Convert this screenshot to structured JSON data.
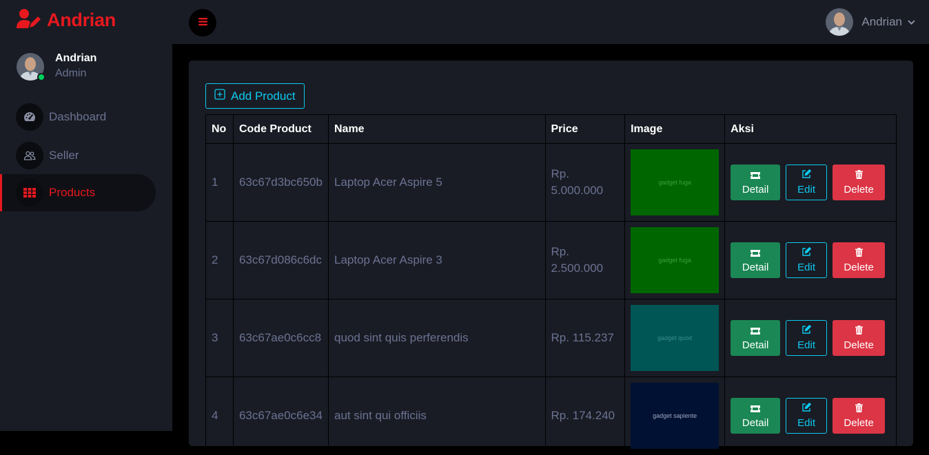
{
  "brand": {
    "name": "Andrian"
  },
  "profile": {
    "name": "Andrian",
    "role": "Admin"
  },
  "nav": [
    {
      "label": "Dashboard",
      "icon": "speedometer-icon"
    },
    {
      "label": "Seller",
      "icon": "people-icon"
    },
    {
      "label": "Products",
      "icon": "grid-icon",
      "active": true
    }
  ],
  "topbar": {
    "username": "Andrian"
  },
  "toolbar": {
    "add_label": "Add Product"
  },
  "table": {
    "headers": [
      "No",
      "Code Product",
      "Name",
      "Price",
      "Image",
      "Aksi"
    ],
    "rows": [
      {
        "no": "1",
        "code": "63c67d3bc650b",
        "name": "Laptop Acer Aspire 5",
        "price": "Rp. 5.000.000",
        "image_text": "gadget fuga",
        "image_bg": "#006600",
        "image_fg": "#3aa23a"
      },
      {
        "no": "2",
        "code": "63c67d086c6dc",
        "name": "Laptop Acer Aspire 3",
        "price": "Rp. 2.500.000",
        "image_text": "gadget fuga",
        "image_bg": "#006600",
        "image_fg": "#3aa23a"
      },
      {
        "no": "3",
        "code": "63c67ae0c6cc8",
        "name": "quod sint quis perferendis",
        "price": "Rp. 115.237",
        "image_text": "gadget quod",
        "image_bg": "#005555",
        "image_fg": "#3b8d8d"
      },
      {
        "no": "4",
        "code": "63c67ae0c6e34",
        "name": "aut sint qui officiis",
        "price": "Rp. 174.240",
        "image_text": "gadget sapiente",
        "image_bg": "#001133",
        "image_fg": "#a0a8c0"
      }
    ],
    "actions": {
      "detail": "Detail",
      "edit": "Edit",
      "delete": "Delete"
    }
  },
  "colors": {
    "accent": "#e8181f",
    "info": "#0dcaf0",
    "success": "#1b8754",
    "danger": "#dc3545",
    "online": "#00d25b"
  }
}
